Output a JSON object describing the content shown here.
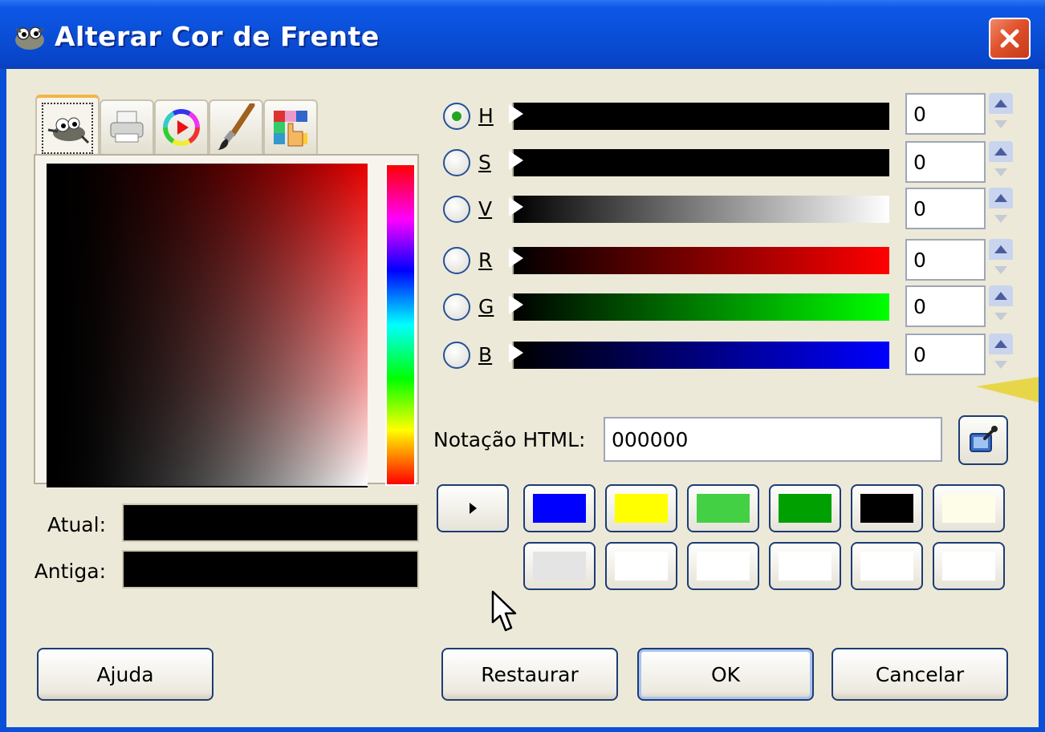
{
  "window": {
    "title": "Alterar Cor de Frente",
    "close_icon": "close-icon"
  },
  "tabs": [
    {
      "name": "gimp-selector-tab",
      "icon": "gimp-wilber-icon",
      "active": true
    },
    {
      "name": "cmyk-selector-tab",
      "icon": "printer-icon",
      "active": false
    },
    {
      "name": "wheel-selector-tab",
      "icon": "color-wheel-icon",
      "active": false
    },
    {
      "name": "watercolor-selector-tab",
      "icon": "paintbrush-icon",
      "active": false
    },
    {
      "name": "palette-selector-tab",
      "icon": "palette-hand-icon",
      "active": false
    }
  ],
  "current": {
    "label": "Atual:",
    "color": "#000000"
  },
  "old": {
    "label": "Antiga:",
    "color": "#000000"
  },
  "channels": [
    {
      "label": "H",
      "value": "0",
      "selected": true
    },
    {
      "label": "S",
      "value": "0",
      "selected": false
    },
    {
      "label": "V",
      "value": "0",
      "selected": false
    },
    {
      "label": "R",
      "value": "0",
      "selected": false
    },
    {
      "label": "G",
      "value": "0",
      "selected": false
    },
    {
      "label": "B",
      "value": "0",
      "selected": false
    }
  ],
  "html_notation": {
    "label": "Notação HTML:",
    "value": "000000"
  },
  "history": {
    "row1": [
      "#0000ff",
      "#ffff00",
      "#44d044",
      "#00a000",
      "#000000",
      "#fefee8"
    ],
    "row2": [
      "#e4e4e4",
      "#ffffff",
      "#ffffff",
      "#ffffff",
      "#ffffff",
      "#ffffff"
    ]
  },
  "buttons": {
    "help": "Ajuda",
    "reset": "Restaurar",
    "ok": "OK",
    "cancel": "Cancelar"
  }
}
